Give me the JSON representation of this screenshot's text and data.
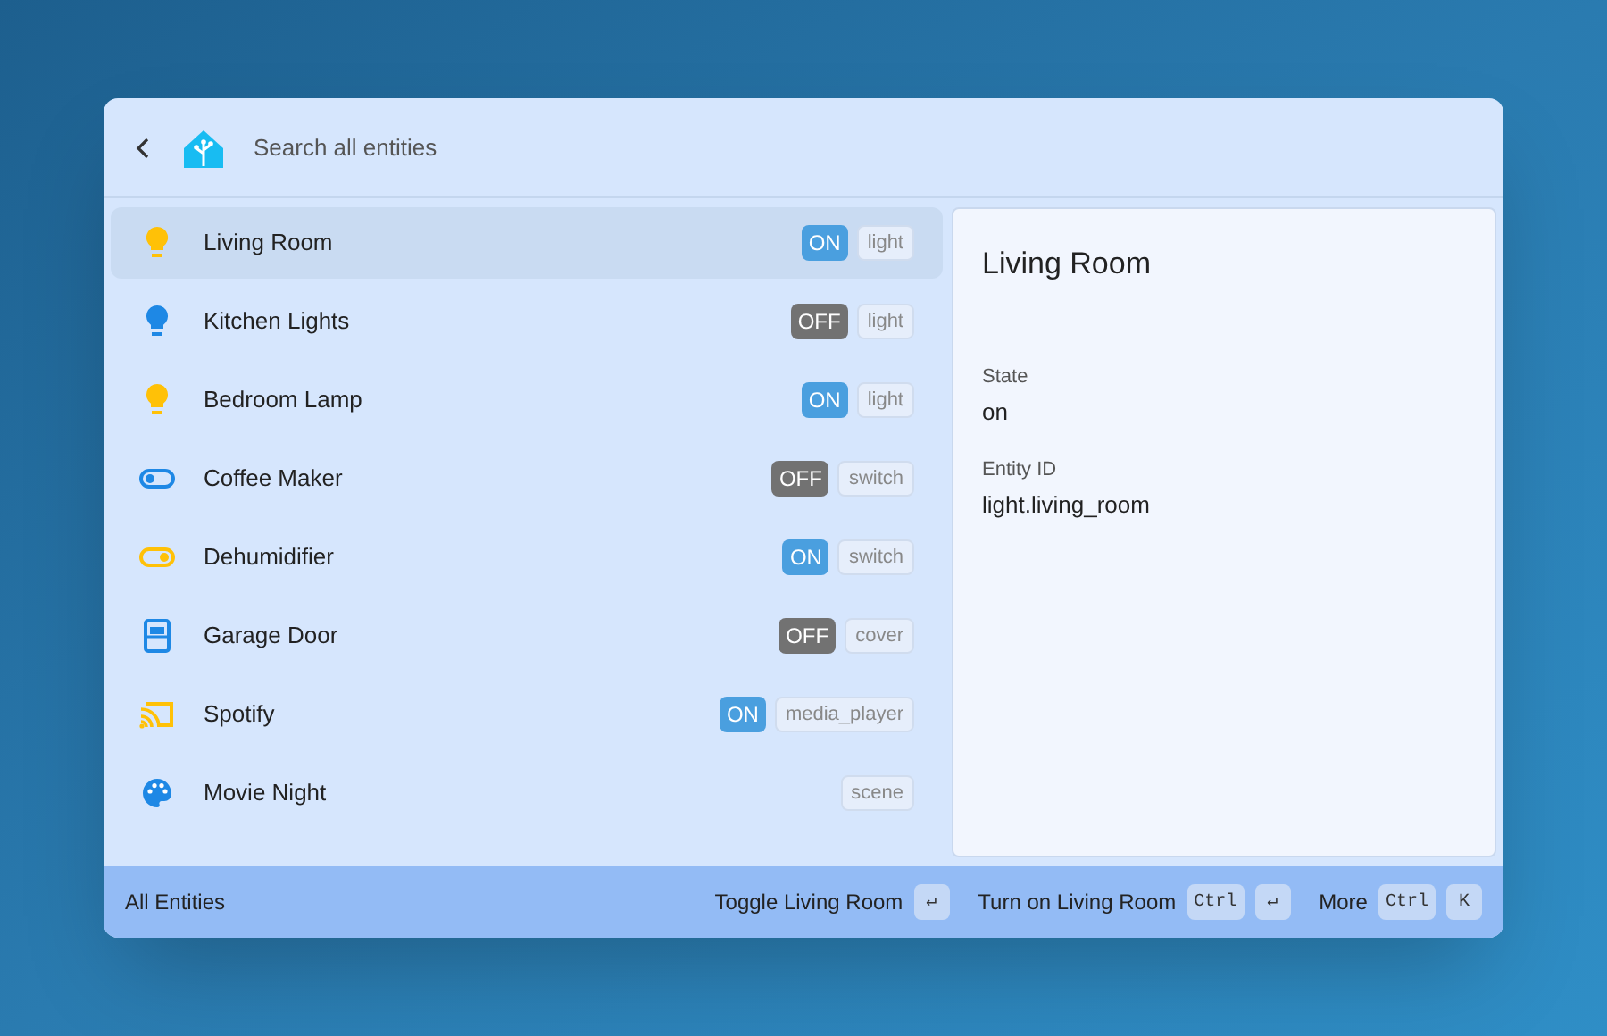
{
  "search": {
    "placeholder": "Search all entities"
  },
  "entities": [
    {
      "name": "Living Room",
      "kind": "light",
      "color": "#ffc107",
      "state": "ON",
      "on": true,
      "domain": "light",
      "selected": true
    },
    {
      "name": "Kitchen Lights",
      "kind": "light",
      "color": "#1e88e5",
      "state": "OFF",
      "on": false,
      "domain": "light",
      "selected": false
    },
    {
      "name": "Bedroom Lamp",
      "kind": "light",
      "color": "#ffc107",
      "state": "ON",
      "on": true,
      "domain": "light",
      "selected": false
    },
    {
      "name": "Coffee Maker",
      "kind": "switch",
      "color": "#1e88e5",
      "state": "OFF",
      "on": false,
      "domain": "switch",
      "selected": false
    },
    {
      "name": "Dehumidifier",
      "kind": "switch",
      "color": "#ffc107",
      "state": "ON",
      "on": true,
      "domain": "switch",
      "selected": false
    },
    {
      "name": "Garage Door",
      "kind": "cover",
      "color": "#1e88e5",
      "state": "OFF",
      "on": false,
      "domain": "cover",
      "selected": false
    },
    {
      "name": "Spotify",
      "kind": "media",
      "color": "#ffc107",
      "state": "ON",
      "on": true,
      "domain": "media_player",
      "selected": false
    },
    {
      "name": "Movie Night",
      "kind": "scene",
      "color": "#1e88e5",
      "domain": "scene",
      "selected": false
    }
  ],
  "detail": {
    "title": "Living Room",
    "fields": [
      {
        "label": "State",
        "value": "on"
      },
      {
        "label": "Entity ID",
        "value": "light.living_room"
      }
    ]
  },
  "footer": {
    "label": "All Entities",
    "actions": [
      {
        "label": "Toggle Living Room",
        "keys": [
          "↵"
        ]
      },
      {
        "label": "Turn on Living Room",
        "keys": [
          "Ctrl",
          "↵"
        ]
      },
      {
        "label": "More",
        "keys": [
          "Ctrl",
          "K"
        ]
      }
    ]
  }
}
